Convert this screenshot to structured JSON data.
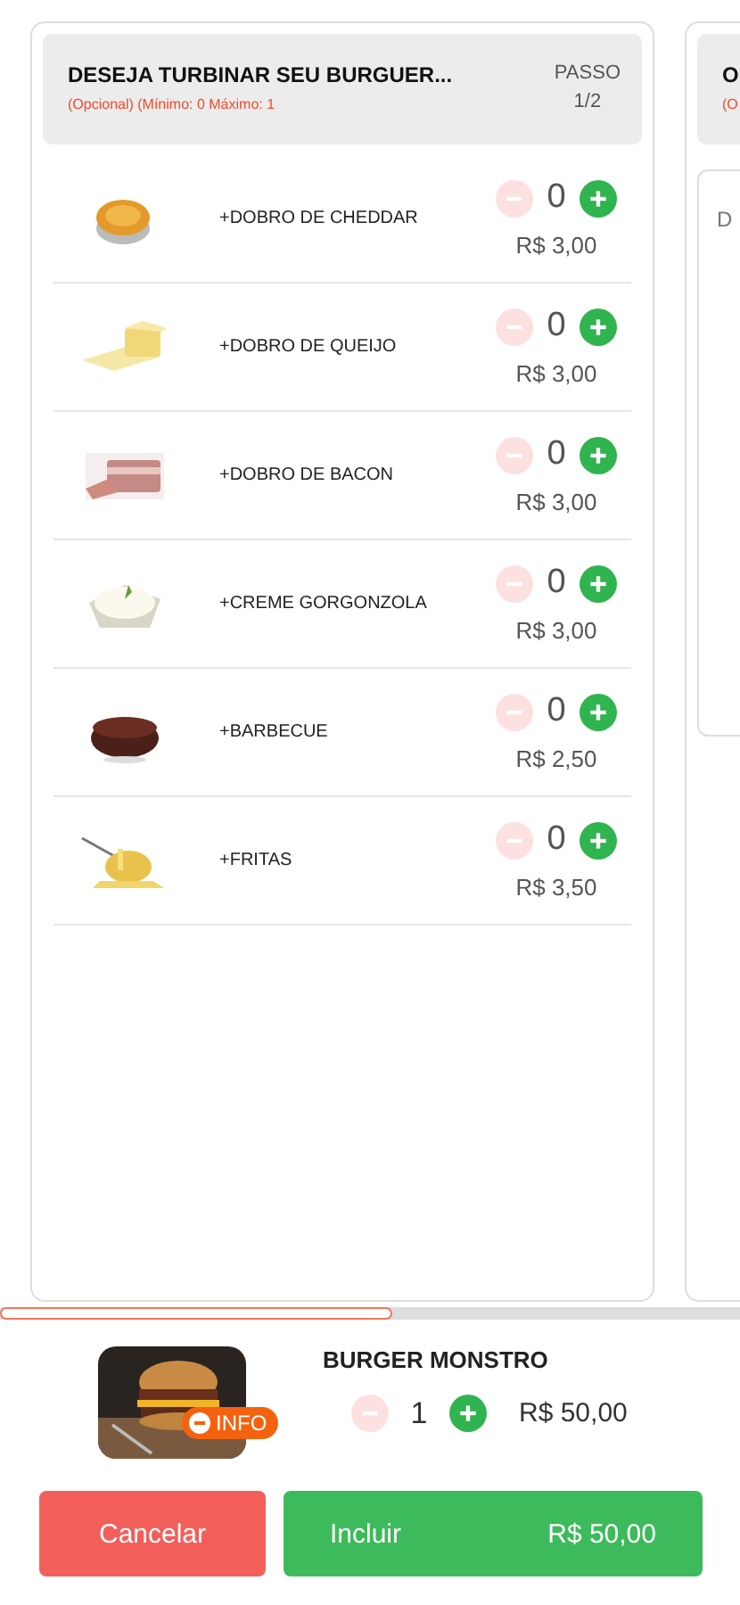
{
  "steps": [
    {
      "title": "DESEJA TURBINAR SEU BURGUER...",
      "subtitle": "(Opcional) (Mínimo: 0 Máximo: 1",
      "step_label": "PASSO",
      "step_value": "1/2",
      "items": [
        {
          "name": "+DOBRO DE CHEDDAR",
          "quantity": "0",
          "price": "R$ 3,00",
          "decrease_disabled": true
        },
        {
          "name": "+DOBRO DE QUEIJO",
          "quantity": "0",
          "price": "R$ 3,00",
          "decrease_disabled": true
        },
        {
          "name": "+DOBRO DE BACON",
          "quantity": "0",
          "price": "R$ 3,00",
          "decrease_disabled": true
        },
        {
          "name": "+CREME GORGONZOLA",
          "quantity": "0",
          "price": "R$ 3,00",
          "decrease_disabled": true
        },
        {
          "name": "+BARBECUE",
          "quantity": "0",
          "price": "R$ 2,50",
          "decrease_disabled": true
        },
        {
          "name": "+FRITAS",
          "quantity": "0",
          "price": "R$ 3,50",
          "decrease_disabled": true
        }
      ]
    },
    {
      "title": "O",
      "subtitle": "(O",
      "field_text": "D"
    }
  ],
  "product": {
    "name": "BURGER MONSTRO",
    "info_label": "INFO",
    "quantity": "1",
    "price": "R$ 50,00",
    "decrease_disabled": true
  },
  "buttons": {
    "cancel": "Cancelar",
    "confirm": "Incluir",
    "confirm_total": "R$ 50,00"
  }
}
